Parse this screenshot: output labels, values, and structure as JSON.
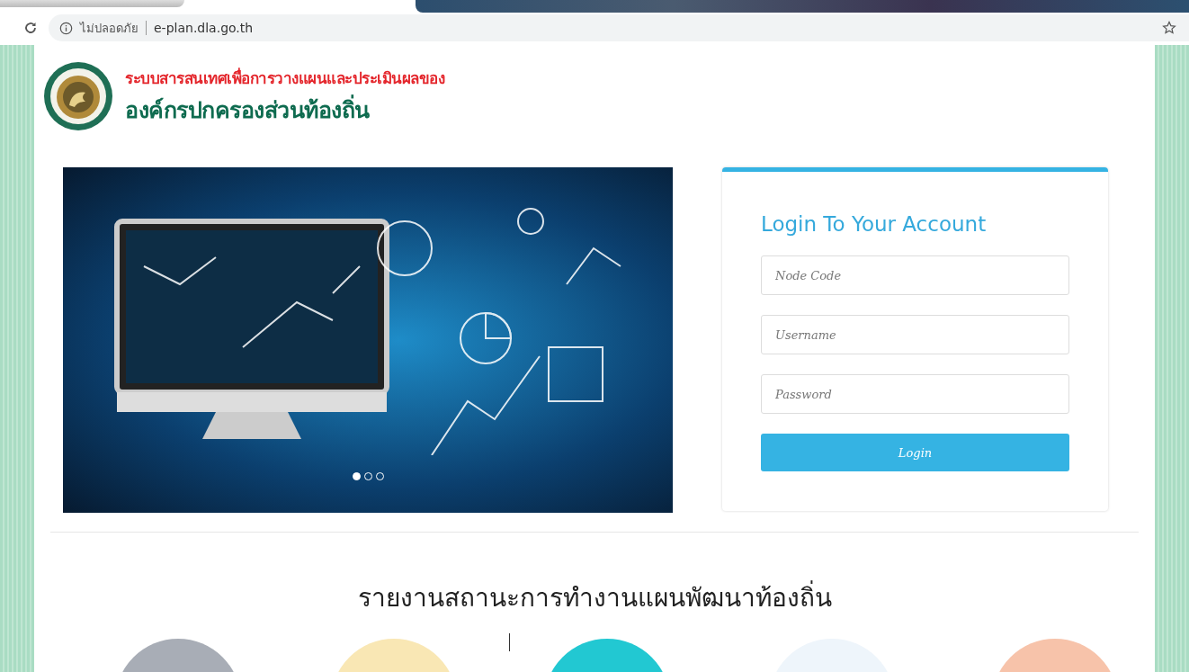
{
  "browser": {
    "security_label": "ไม่ปลอดภัย",
    "url": "e-plan.dla.go.th"
  },
  "header": {
    "line_1": "ระบบสารสนเทศเพื่อการวางแผนและประเมินผลของ",
    "line_2": "องค์กรปกครองส่วนท้องถิ่น"
  },
  "carousel": {
    "slides": [
      {
        "selected": true
      },
      {
        "selected": false
      },
      {
        "selected": false
      }
    ]
  },
  "login": {
    "title": "Login To Your Account",
    "fields": [
      {
        "placeholder": "Node Code"
      },
      {
        "placeholder": "Username"
      },
      {
        "placeholder": "Password"
      }
    ],
    "button": "Login"
  },
  "report": {
    "title": "รายงานสถานะการทำงานแผนพัฒนาท้องถิ่น"
  }
}
